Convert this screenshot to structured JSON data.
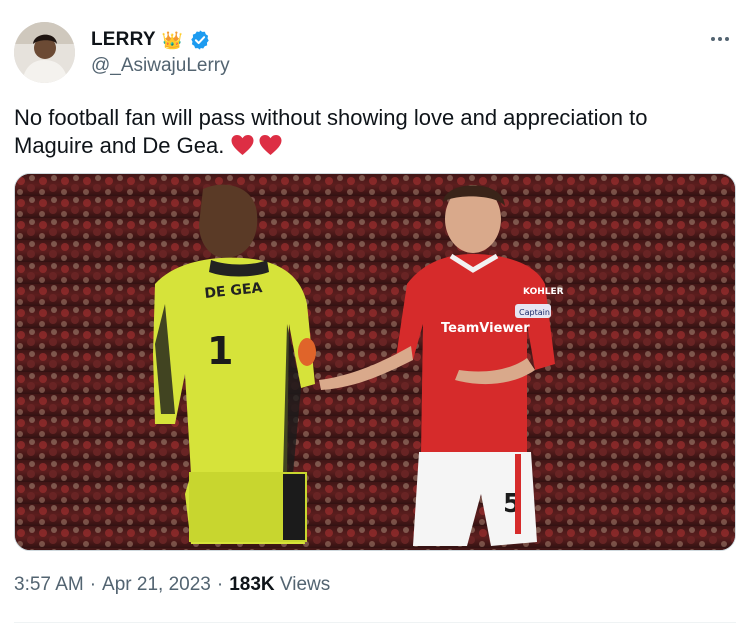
{
  "author": {
    "display_name": "LERRY",
    "crown_emoji": "👑",
    "handle": "@_AsiwajuLerry",
    "verified": true
  },
  "tweet": {
    "text": "No football fan will pass without showing love and appreciation to Maguire and De Gea.",
    "hearts": [
      "❤️",
      "❤️"
    ]
  },
  "media": {
    "jersey_name": "DE GEA",
    "keeper_number": "1",
    "sponsor": "TeamViewer",
    "shorts_number": "5",
    "captain_band": "Captain",
    "sleeve_sponsor": "KOHLER"
  },
  "meta": {
    "time": "3:57 AM",
    "separator": "·",
    "date": "Apr 21, 2023",
    "views_count": "183K",
    "views_label": "Views"
  },
  "colors": {
    "verified_blue": "#1d9bf0",
    "heart_red": "#e0245e",
    "secondary_text": "#536471"
  }
}
